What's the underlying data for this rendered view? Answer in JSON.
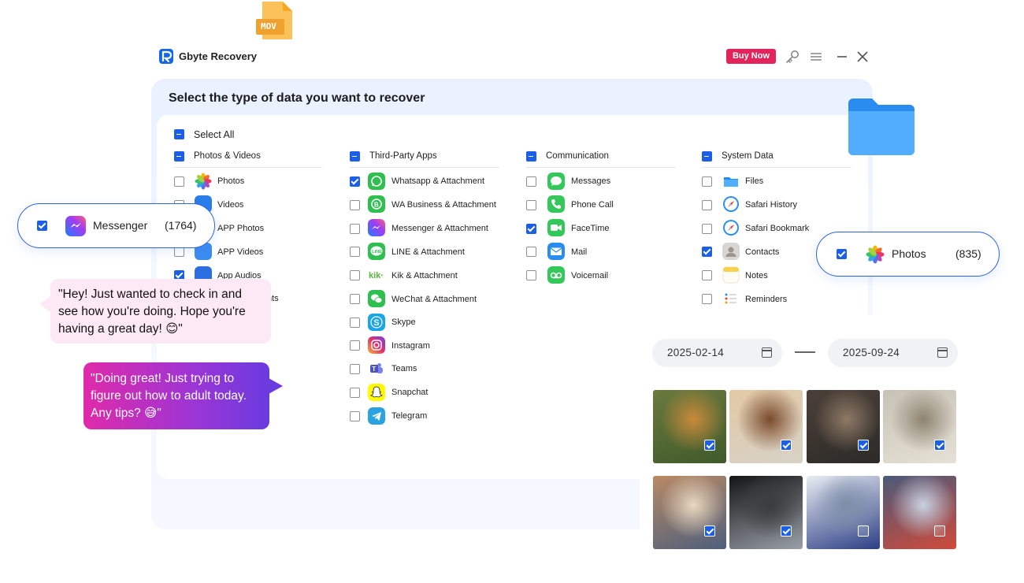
{
  "app": {
    "title": "Gbyte Recovery",
    "buy_label": "Buy Now"
  },
  "heading": "Select the type of data you want to recover",
  "select_all": "Select All",
  "file_badge": "MOV",
  "categories": [
    {
      "title": "Photos & Videos",
      "items": [
        {
          "label": "Photos",
          "checked": false
        },
        {
          "label": "Videos",
          "checked": false
        },
        {
          "label": "APP Photos",
          "checked": false
        },
        {
          "label": "APP Videos",
          "checked": false
        },
        {
          "label": "App Audios",
          "checked": true
        },
        {
          "label": "nts",
          "checked": false
        }
      ]
    },
    {
      "title": "Third-Party Apps",
      "items": [
        {
          "label": "Whatsapp & Attachment",
          "checked": true
        },
        {
          "label": "WA Business & Attachment",
          "checked": false
        },
        {
          "label": "Messenger & Attachment",
          "checked": false
        },
        {
          "label": "LINE & Attachment",
          "checked": false
        },
        {
          "label": "Kik & Attachment",
          "checked": false
        },
        {
          "label": "WeChat & Attachment",
          "checked": false
        },
        {
          "label": "Skype",
          "checked": false
        },
        {
          "label": "Instagram",
          "checked": false
        },
        {
          "label": "Teams",
          "checked": false
        },
        {
          "label": "Snapchat",
          "checked": false
        },
        {
          "label": "Telegram",
          "checked": false
        }
      ]
    },
    {
      "title": "Communication",
      "items": [
        {
          "label": "Messages",
          "checked": false
        },
        {
          "label": "Phone Call",
          "checked": false
        },
        {
          "label": "FaceTime",
          "checked": true
        },
        {
          "label": "Mail",
          "checked": false
        },
        {
          "label": "Voicemail",
          "checked": false
        }
      ]
    },
    {
      "title": "System Data",
      "items": [
        {
          "label": "Files",
          "checked": false
        },
        {
          "label": "Safari History",
          "checked": false
        },
        {
          "label": "Safari Bookmark",
          "checked": false
        },
        {
          "label": "Contacts",
          "checked": true
        },
        {
          "label": "Notes",
          "checked": false
        },
        {
          "label": "Reminders",
          "checked": false
        }
      ]
    }
  ],
  "messenger_card": {
    "label": "Messenger",
    "count": "(1764)"
  },
  "photos_card": {
    "label": "Photos",
    "count": "(835)"
  },
  "chat": {
    "incoming": "\"Hey! Just wanted to check in and see how you're doing. Hope you're having a great day! 😊\"",
    "outgoing": "\"Doing great! Just trying to figure out how to adult today. Any tips? 😅\""
  },
  "date_range": {
    "from": "2025-02-14",
    "to": "2025-09-24"
  },
  "thumbnails": [
    {
      "name": "autumn-tree",
      "checked": true,
      "colors": [
        "#6b7a3e",
        "#c98a3a",
        "#3f5a2a"
      ]
    },
    {
      "name": "friends-selfie",
      "checked": true,
      "colors": [
        "#e3c9a4",
        "#7a4a2c",
        "#d7d2c8"
      ]
    },
    {
      "name": "city-street",
      "checked": true,
      "colors": [
        "#4b4038",
        "#8e7a66",
        "#2c2a28"
      ]
    },
    {
      "name": "old-town-alley",
      "checked": true,
      "colors": [
        "#c8c2b6",
        "#8e8470",
        "#e6e1d6"
      ]
    },
    {
      "name": "food-table",
      "checked": true,
      "colors": [
        "#b98a64",
        "#e8d8c0",
        "#4e5f7c"
      ]
    },
    {
      "name": "night-portrait",
      "checked": true,
      "colors": [
        "#141414",
        "#3b3b3b",
        "#9aa0aa"
      ]
    },
    {
      "name": "snowboarder",
      "checked": false,
      "colors": [
        "#e8ecf2",
        "#7d8ea8",
        "#2c3f86"
      ]
    },
    {
      "name": "winter-couple",
      "checked": false,
      "colors": [
        "#4a5a7a",
        "#c9d3e2",
        "#d04a3a"
      ]
    }
  ]
}
